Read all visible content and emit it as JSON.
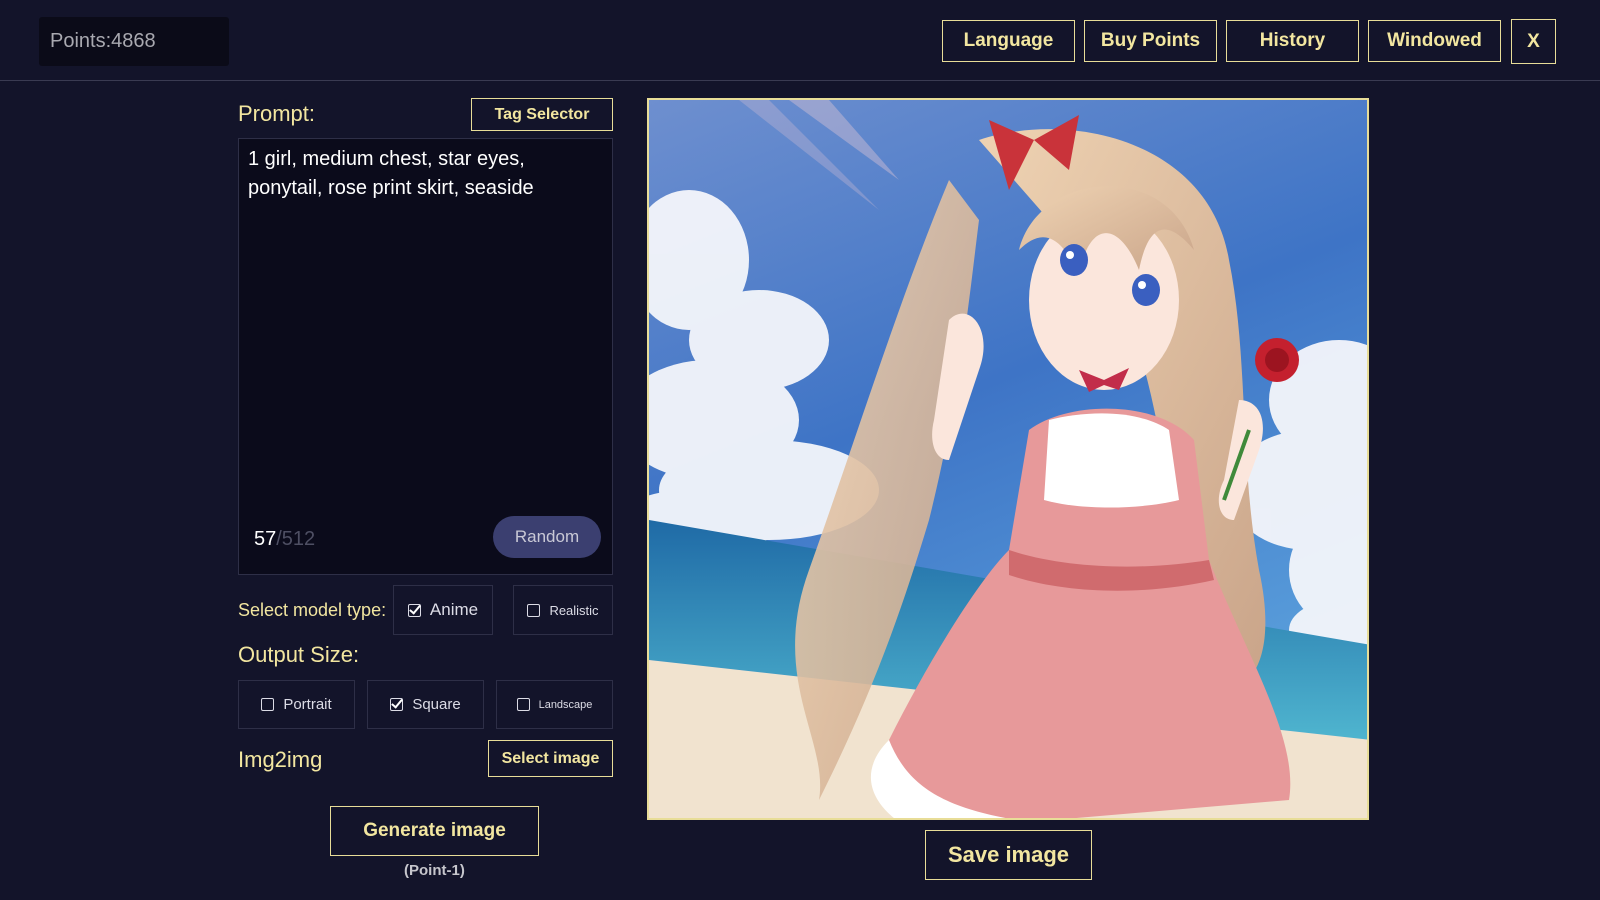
{
  "topbar": {
    "points_text": "Points:4868",
    "language_label": "Language",
    "buy_points_label": "Buy Points",
    "history_label": "History",
    "windowed_label": "Windowed",
    "close_label": "X"
  },
  "prompt": {
    "label": "Prompt:",
    "tag_selector_label": "Tag Selector",
    "text": "1 girl, medium chest, star eyes, ponytail, rose print skirt, seaside",
    "char_count": "57",
    "char_max": "/512",
    "random_label": "Random"
  },
  "model": {
    "label": "Select model type:",
    "options": [
      {
        "label": "Anime",
        "checked": true
      },
      {
        "label": "Realistic",
        "checked": false
      }
    ]
  },
  "output_size": {
    "label": "Output Size:",
    "options": [
      {
        "label": "Portrait",
        "checked": false
      },
      {
        "label": "Square",
        "checked": true
      },
      {
        "label": "Landscape",
        "checked": false
      }
    ]
  },
  "img2img": {
    "label": "Img2img",
    "select_label": "Select image"
  },
  "generate": {
    "label": "Generate image",
    "cost_note": "(Point-1)"
  },
  "result": {
    "save_label": "Save image"
  },
  "colors": {
    "background": "#13142a",
    "accent": "#f2e6a0",
    "random_button": "#3b3f70"
  }
}
